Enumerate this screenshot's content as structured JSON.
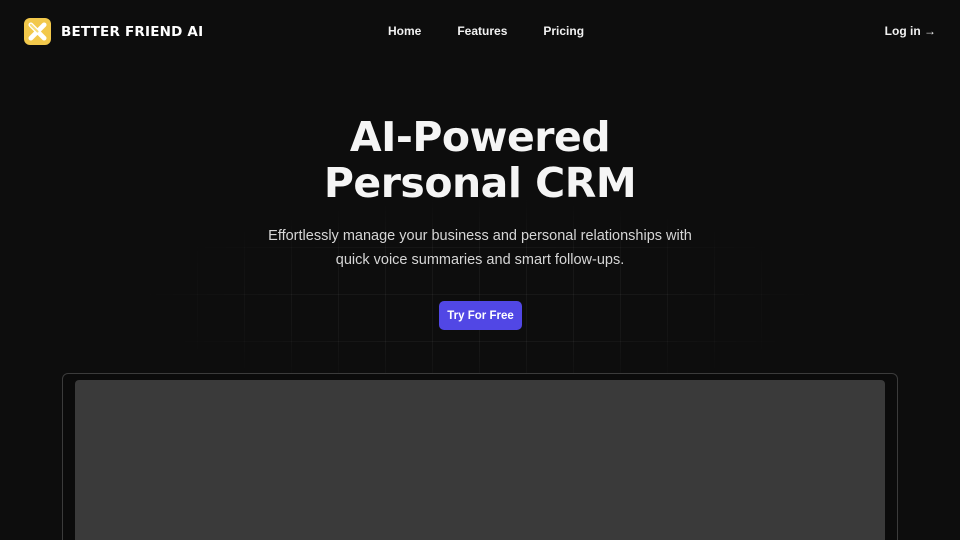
{
  "brand": {
    "name": "BETTER FRIEND AI",
    "logo_icon": "x-logo-icon",
    "logo_color": "#f2c84b"
  },
  "nav": {
    "links": [
      {
        "label": "Home"
      },
      {
        "label": "Features"
      },
      {
        "label": "Pricing"
      }
    ],
    "login_label": "Log in →"
  },
  "hero": {
    "title_line1": "AI-Powered",
    "title_line2": "Personal CRM",
    "subtitle_line1": "Effortlessly manage your business and personal relationships with",
    "subtitle_line2": "quick voice summaries and smart follow-ups.",
    "cta_label": "Try For Free",
    "cta_color": "#5147e5"
  },
  "theme": {
    "background": "#0d0d0d",
    "preview_screen": "#3a3a3a"
  }
}
